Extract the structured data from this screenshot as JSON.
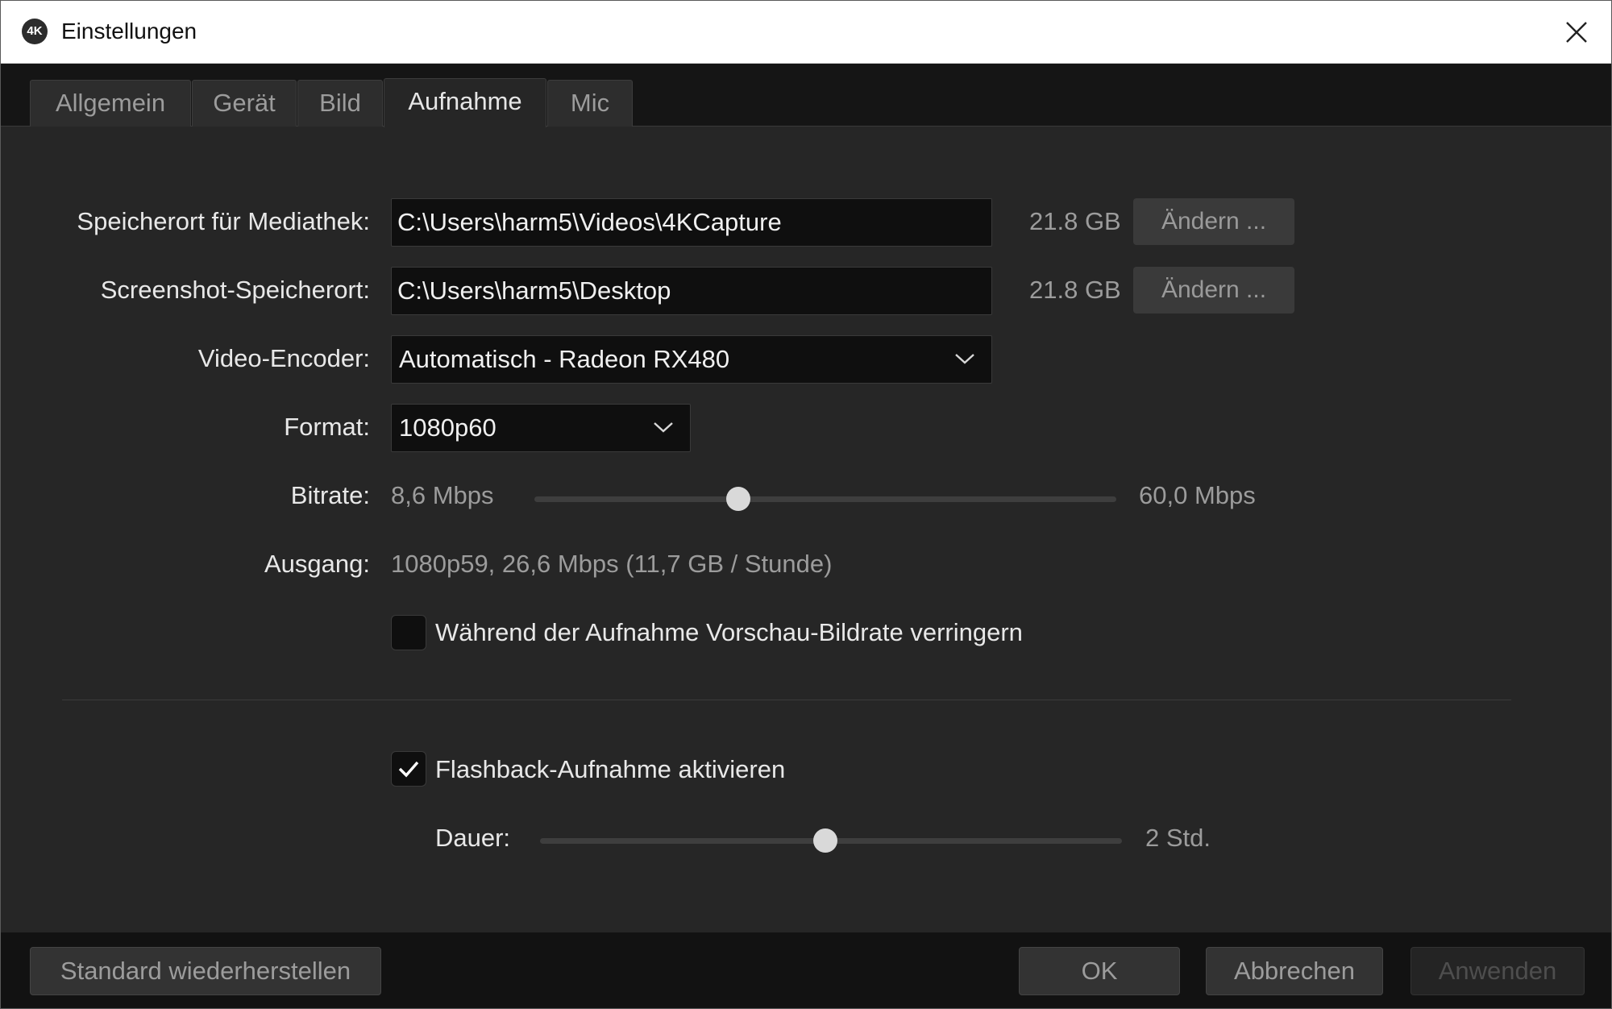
{
  "window": {
    "title": "Einstellungen",
    "app_icon": "4K",
    "close_icon": "close-icon"
  },
  "tabs": [
    {
      "label": "Allgemein",
      "active": false
    },
    {
      "label": "Gerät",
      "active": false
    },
    {
      "label": "Bild",
      "active": false
    },
    {
      "label": "Aufnahme",
      "active": true
    },
    {
      "label": "Mic",
      "active": false
    }
  ],
  "settings": {
    "library": {
      "label": "Speicherort für Mediathek:",
      "value": "C:\\Users\\harm5\\Videos\\4KCapture",
      "free_space": "21.8 GB",
      "button": "Ändern ..."
    },
    "screenshot": {
      "label": "Screenshot-Speicherort:",
      "value": "C:\\Users\\harm5\\Desktop",
      "free_space": "21.8 GB",
      "button": "Ändern ..."
    },
    "encoder": {
      "label": "Video-Encoder:",
      "value": "Automatisch - Radeon RX480"
    },
    "format": {
      "label": "Format:",
      "value": "1080p60"
    },
    "bitrate": {
      "label": "Bitrate:",
      "min": "8,6 Mbps",
      "max": "60,0 Mbps",
      "fraction": 0.35
    },
    "output": {
      "label": "Ausgang:",
      "value": "1080p59, 26,6 Mbps (11,7 GB / Stunde)"
    },
    "reduce_preview": {
      "label": "Während der Aufnahme Vorschau-Bildrate verringern",
      "checked": false
    },
    "flashback": {
      "label": "Flashback-Aufnahme aktivieren",
      "checked": true
    },
    "duration": {
      "label": "Dauer:",
      "value": "2 Std.",
      "fraction": 0.49
    }
  },
  "footer": {
    "restore": "Standard wiederherstellen",
    "ok": "OK",
    "cancel": "Abbrechen",
    "apply": "Anwenden"
  },
  "colors": {
    "background": "#262626",
    "title_bar": "#ffffff",
    "field": "#0f0f0f",
    "text": "#e8e8e8",
    "muted_text": "#9c9c9c"
  }
}
